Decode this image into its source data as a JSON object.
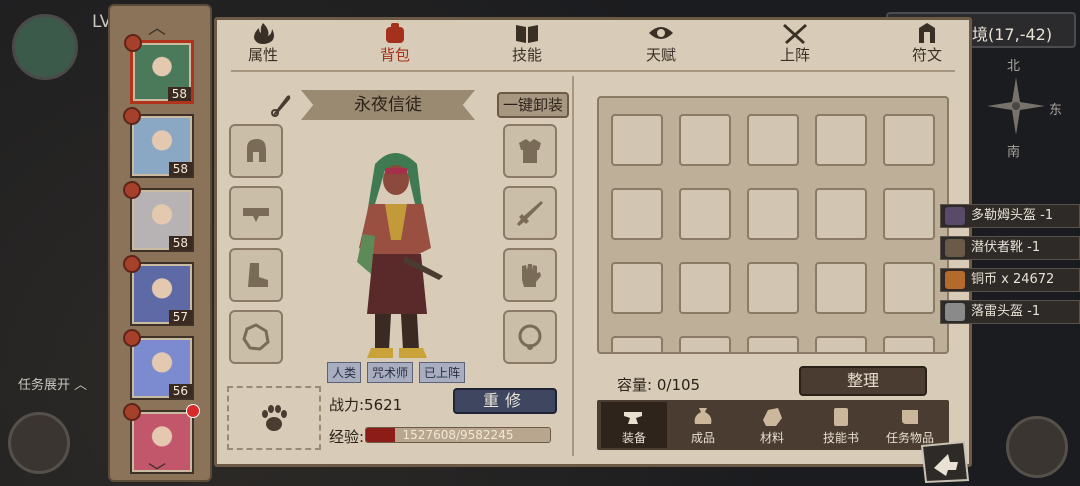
{
  "world": {
    "level_text": "LV",
    "coordinate": "境(17,-42)",
    "compass": {
      "north": "北",
      "south": "南",
      "east": "东"
    },
    "task_toggle": "任务展开"
  },
  "heroes": [
    {
      "level": "58",
      "badge": "",
      "active": true,
      "color": "#4a7a5a"
    },
    {
      "level": "58",
      "badge": "",
      "active": false,
      "color": "#8aa7c4"
    },
    {
      "level": "58",
      "badge": "",
      "active": false,
      "color": "#b7b3b5"
    },
    {
      "level": "57",
      "badge": "",
      "active": false,
      "color": "#5d6aa6"
    },
    {
      "level": "56",
      "badge": "",
      "active": false,
      "color": "#7c8bd0"
    },
    {
      "level": "",
      "badge": "",
      "active": false,
      "color": "#c2566a",
      "red_dot": true
    }
  ],
  "tabs": [
    {
      "label": "属性",
      "icon": "flame-icon"
    },
    {
      "label": "背包",
      "icon": "backpack-icon",
      "active": true
    },
    {
      "label": "技能",
      "icon": "book-icon"
    },
    {
      "label": "天赋",
      "icon": "eye-icon"
    },
    {
      "label": "上阵",
      "icon": "crossed-swords-icon"
    },
    {
      "label": "符文",
      "icon": "rune-icon"
    }
  ],
  "hero": {
    "name": "永夜信徒",
    "unequip_all": "一键卸装",
    "tags": [
      "人类",
      "咒术师",
      "已上阵"
    ],
    "power_label": "战力:5621",
    "rebuild_label": "重修",
    "exp_label": "经验:",
    "exp_text": "1527608/9582245",
    "exp_fraction": 0.159
  },
  "inventory": {
    "capacity_label": "容量:",
    "capacity_value": "0/105",
    "sort_label": "整理",
    "categories": [
      {
        "label": "装备",
        "icon": "anvil-icon",
        "active": true
      },
      {
        "label": "成品",
        "icon": "sack-icon"
      },
      {
        "label": "材料",
        "icon": "ore-icon"
      },
      {
        "label": "技能书",
        "icon": "scroll-icon"
      },
      {
        "label": "任务物品",
        "icon": "quest-scroll-icon"
      }
    ]
  },
  "toasts": [
    {
      "text": "多勒姆头盔 -1",
      "icon_color": "#5a4a6a"
    },
    {
      "text": "潜伏者靴 -1",
      "icon_color": "#6a5a48"
    },
    {
      "text": "铜币 x 24672",
      "icon_color": "#b36a2a"
    },
    {
      "text": "落雷头盔 -1",
      "icon_color": "#8a8a8a"
    }
  ]
}
